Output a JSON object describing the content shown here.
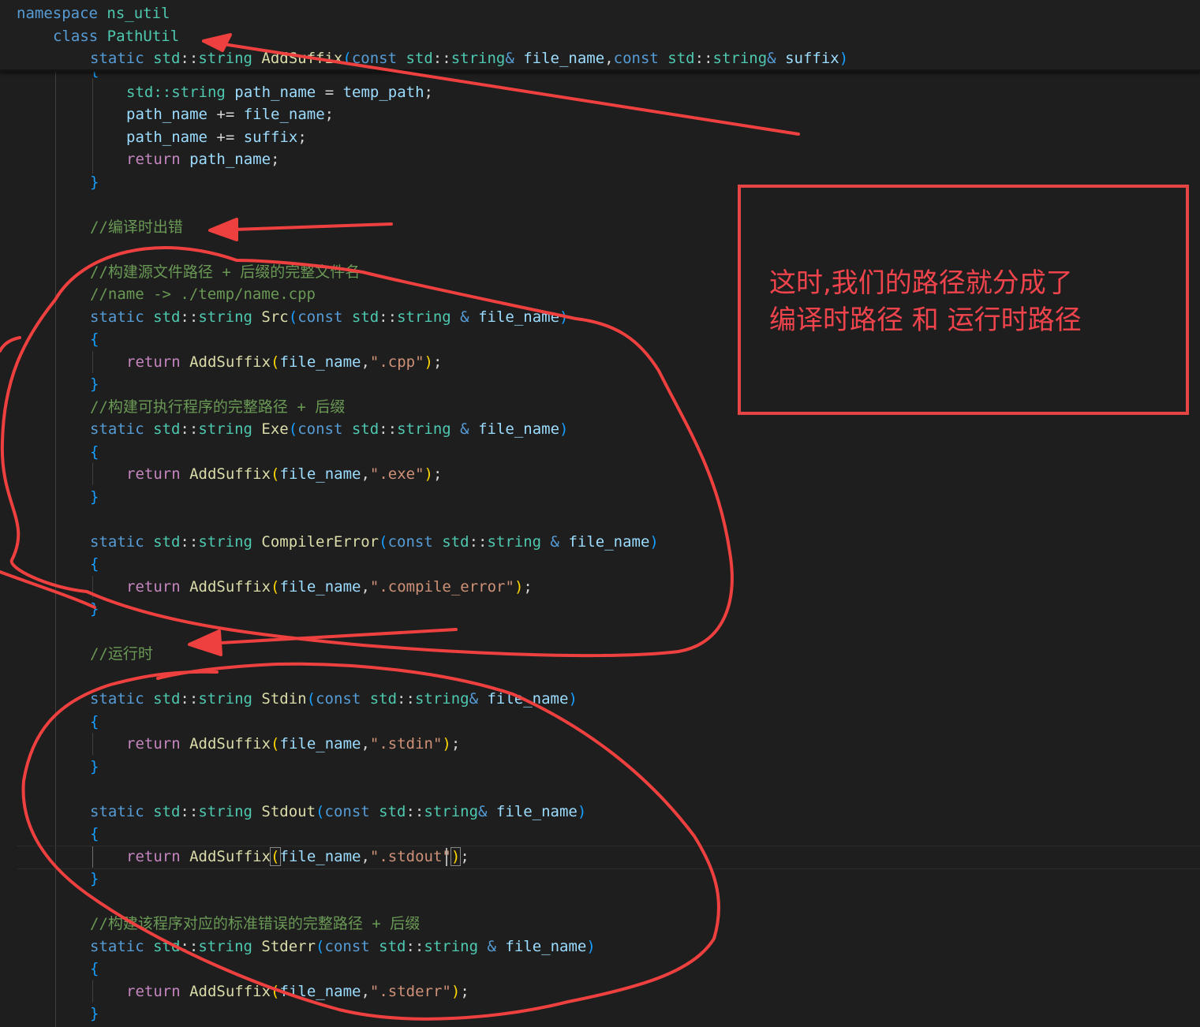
{
  "editor": {
    "sticky": {
      "namespace_kw": "namespace",
      "namespace_name": "ns_util",
      "class_kw": "class",
      "class_name": "PathUtil",
      "sig": {
        "static": "static",
        "std": "std",
        "string": "string",
        "name": "AddSuffix",
        "const1": "const",
        "type1": "string",
        "p1": "file_name",
        "const2": "const",
        "type2": "string",
        "p2": "suffix"
      }
    },
    "body": {
      "l1_type": "std::string",
      "l1_var": "path_name",
      "l1_rhs": "temp_path",
      "l2_var": "path_name",
      "l2_rhs": "file_name",
      "l3_var": "path_name",
      "l3_rhs": "suffix",
      "ret_kw": "return",
      "ret_var": "path_name"
    },
    "comment_compile": "//编译时出错",
    "comment_src1": "//构建源文件路径 + 后缀的完整文件名",
    "comment_src2": "//name -> ./temp/name.cpp",
    "comment_exe": "//构建可执行程序的完整路径 + 后缀",
    "comment_run": "//运行时",
    "comment_stderr": "//构建该程序对应的标准错误的完整路径 + 后缀",
    "static_kw": "static",
    "std_ns": "std",
    "string_ty": "string",
    "const_kw": "const",
    "return_kw": "return",
    "addsuffix": "AddSuffix",
    "param": "file_name",
    "functions": {
      "src": {
        "name": "Src",
        "ext": "\".cpp\""
      },
      "exe": {
        "name": "Exe",
        "ext": "\".exe\""
      },
      "cerr": {
        "name": "CompilerError",
        "ext": "\".compile_error\""
      },
      "stdin": {
        "name": "Stdin",
        "ext": "\".stdin\""
      },
      "stdout": {
        "name": "Stdout",
        "ext": "\".stdout\""
      },
      "stderr": {
        "name": "Stderr",
        "ext": "\".stderr\""
      }
    }
  },
  "annotation": {
    "line1": "这时,我们的路径就分成了",
    "line2": "编译时路径 和 运行时路径",
    "color": "#e64545"
  }
}
